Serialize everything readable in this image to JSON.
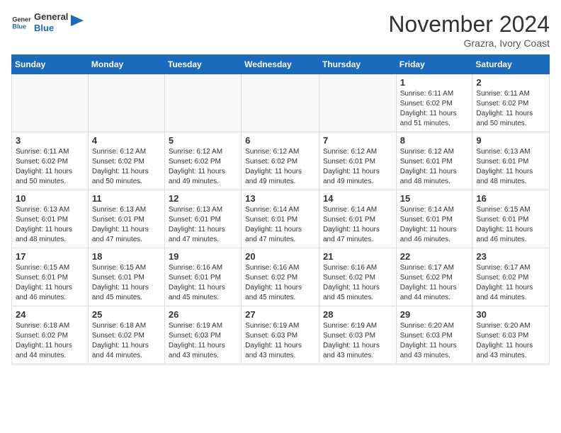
{
  "header": {
    "logo_line1": "General",
    "logo_line2": "Blue",
    "month_title": "November 2024",
    "location": "Grazra, Ivory Coast"
  },
  "days_of_week": [
    "Sunday",
    "Monday",
    "Tuesday",
    "Wednesday",
    "Thursday",
    "Friday",
    "Saturday"
  ],
  "weeks": [
    [
      {
        "day": "",
        "sunrise": "",
        "sunset": "",
        "daylight": ""
      },
      {
        "day": "",
        "sunrise": "",
        "sunset": "",
        "daylight": ""
      },
      {
        "day": "",
        "sunrise": "",
        "sunset": "",
        "daylight": ""
      },
      {
        "day": "",
        "sunrise": "",
        "sunset": "",
        "daylight": ""
      },
      {
        "day": "",
        "sunrise": "",
        "sunset": "",
        "daylight": ""
      },
      {
        "day": "1",
        "sunrise": "Sunrise: 6:11 AM",
        "sunset": "Sunset: 6:02 PM",
        "daylight": "Daylight: 11 hours and 51 minutes."
      },
      {
        "day": "2",
        "sunrise": "Sunrise: 6:11 AM",
        "sunset": "Sunset: 6:02 PM",
        "daylight": "Daylight: 11 hours and 50 minutes."
      }
    ],
    [
      {
        "day": "3",
        "sunrise": "Sunrise: 6:11 AM",
        "sunset": "Sunset: 6:02 PM",
        "daylight": "Daylight: 11 hours and 50 minutes."
      },
      {
        "day": "4",
        "sunrise": "Sunrise: 6:12 AM",
        "sunset": "Sunset: 6:02 PM",
        "daylight": "Daylight: 11 hours and 50 minutes."
      },
      {
        "day": "5",
        "sunrise": "Sunrise: 6:12 AM",
        "sunset": "Sunset: 6:02 PM",
        "daylight": "Daylight: 11 hours and 49 minutes."
      },
      {
        "day": "6",
        "sunrise": "Sunrise: 6:12 AM",
        "sunset": "Sunset: 6:02 PM",
        "daylight": "Daylight: 11 hours and 49 minutes."
      },
      {
        "day": "7",
        "sunrise": "Sunrise: 6:12 AM",
        "sunset": "Sunset: 6:01 PM",
        "daylight": "Daylight: 11 hours and 49 minutes."
      },
      {
        "day": "8",
        "sunrise": "Sunrise: 6:12 AM",
        "sunset": "Sunset: 6:01 PM",
        "daylight": "Daylight: 11 hours and 48 minutes."
      },
      {
        "day": "9",
        "sunrise": "Sunrise: 6:13 AM",
        "sunset": "Sunset: 6:01 PM",
        "daylight": "Daylight: 11 hours and 48 minutes."
      }
    ],
    [
      {
        "day": "10",
        "sunrise": "Sunrise: 6:13 AM",
        "sunset": "Sunset: 6:01 PM",
        "daylight": "Daylight: 11 hours and 48 minutes."
      },
      {
        "day": "11",
        "sunrise": "Sunrise: 6:13 AM",
        "sunset": "Sunset: 6:01 PM",
        "daylight": "Daylight: 11 hours and 47 minutes."
      },
      {
        "day": "12",
        "sunrise": "Sunrise: 6:13 AM",
        "sunset": "Sunset: 6:01 PM",
        "daylight": "Daylight: 11 hours and 47 minutes."
      },
      {
        "day": "13",
        "sunrise": "Sunrise: 6:14 AM",
        "sunset": "Sunset: 6:01 PM",
        "daylight": "Daylight: 11 hours and 47 minutes."
      },
      {
        "day": "14",
        "sunrise": "Sunrise: 6:14 AM",
        "sunset": "Sunset: 6:01 PM",
        "daylight": "Daylight: 11 hours and 47 minutes."
      },
      {
        "day": "15",
        "sunrise": "Sunrise: 6:14 AM",
        "sunset": "Sunset: 6:01 PM",
        "daylight": "Daylight: 11 hours and 46 minutes."
      },
      {
        "day": "16",
        "sunrise": "Sunrise: 6:15 AM",
        "sunset": "Sunset: 6:01 PM",
        "daylight": "Daylight: 11 hours and 46 minutes."
      }
    ],
    [
      {
        "day": "17",
        "sunrise": "Sunrise: 6:15 AM",
        "sunset": "Sunset: 6:01 PM",
        "daylight": "Daylight: 11 hours and 46 minutes."
      },
      {
        "day": "18",
        "sunrise": "Sunrise: 6:15 AM",
        "sunset": "Sunset: 6:01 PM",
        "daylight": "Daylight: 11 hours and 45 minutes."
      },
      {
        "day": "19",
        "sunrise": "Sunrise: 6:16 AM",
        "sunset": "Sunset: 6:01 PM",
        "daylight": "Daylight: 11 hours and 45 minutes."
      },
      {
        "day": "20",
        "sunrise": "Sunrise: 6:16 AM",
        "sunset": "Sunset: 6:02 PM",
        "daylight": "Daylight: 11 hours and 45 minutes."
      },
      {
        "day": "21",
        "sunrise": "Sunrise: 6:16 AM",
        "sunset": "Sunset: 6:02 PM",
        "daylight": "Daylight: 11 hours and 45 minutes."
      },
      {
        "day": "22",
        "sunrise": "Sunrise: 6:17 AM",
        "sunset": "Sunset: 6:02 PM",
        "daylight": "Daylight: 11 hours and 44 minutes."
      },
      {
        "day": "23",
        "sunrise": "Sunrise: 6:17 AM",
        "sunset": "Sunset: 6:02 PM",
        "daylight": "Daylight: 11 hours and 44 minutes."
      }
    ],
    [
      {
        "day": "24",
        "sunrise": "Sunrise: 6:18 AM",
        "sunset": "Sunset: 6:02 PM",
        "daylight": "Daylight: 11 hours and 44 minutes."
      },
      {
        "day": "25",
        "sunrise": "Sunrise: 6:18 AM",
        "sunset": "Sunset: 6:02 PM",
        "daylight": "Daylight: 11 hours and 44 minutes."
      },
      {
        "day": "26",
        "sunrise": "Sunrise: 6:19 AM",
        "sunset": "Sunset: 6:03 PM",
        "daylight": "Daylight: 11 hours and 43 minutes."
      },
      {
        "day": "27",
        "sunrise": "Sunrise: 6:19 AM",
        "sunset": "Sunset: 6:03 PM",
        "daylight": "Daylight: 11 hours and 43 minutes."
      },
      {
        "day": "28",
        "sunrise": "Sunrise: 6:19 AM",
        "sunset": "Sunset: 6:03 PM",
        "daylight": "Daylight: 11 hours and 43 minutes."
      },
      {
        "day": "29",
        "sunrise": "Sunrise: 6:20 AM",
        "sunset": "Sunset: 6:03 PM",
        "daylight": "Daylight: 11 hours and 43 minutes."
      },
      {
        "day": "30",
        "sunrise": "Sunrise: 6:20 AM",
        "sunset": "Sunset: 6:03 PM",
        "daylight": "Daylight: 11 hours and 43 minutes."
      }
    ]
  ]
}
